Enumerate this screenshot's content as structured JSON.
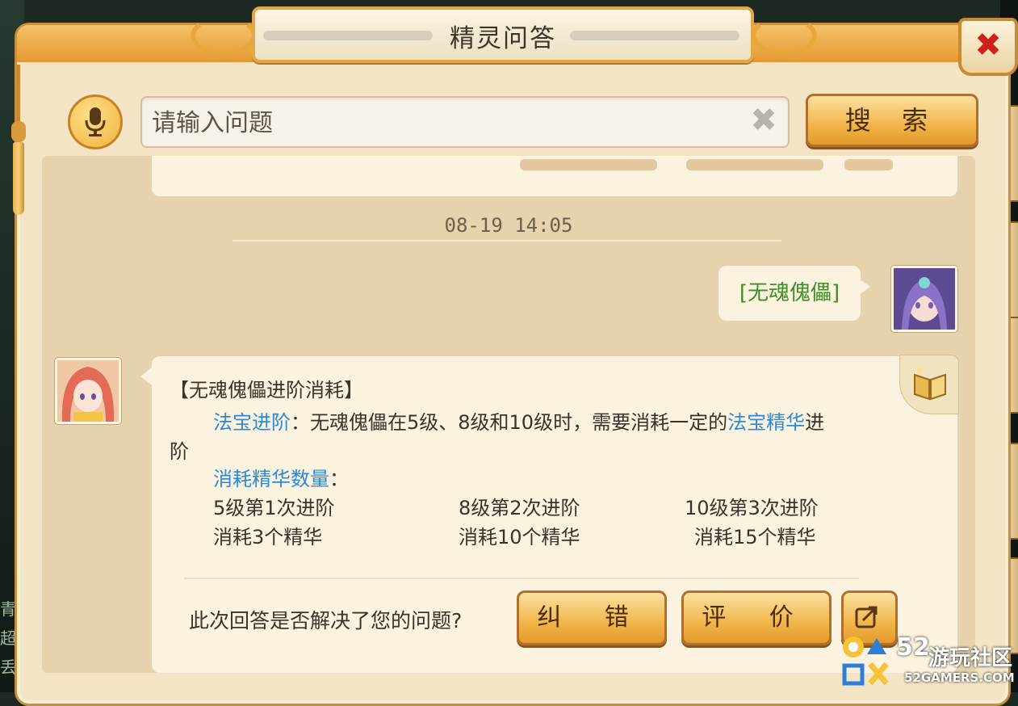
{
  "window": {
    "title": "精灵问答"
  },
  "search": {
    "placeholder": "请输入问题",
    "value": "",
    "button_label": "搜 索"
  },
  "chat": {
    "timestamp": "08-19 14:05",
    "user_message": "[无魂傀儡]",
    "answer": {
      "title": "【无魂傀儡进阶消耗】",
      "line1_link": "法宝进阶",
      "line1_text": "：无魂傀儡在5级、8级和10级时，需要消耗一定的",
      "line1_link2": "法宝精华",
      "line1_tail": "进",
      "line2": "阶",
      "cost_heading": "消耗精华数量",
      "cost_heading_colon": "：",
      "tiers": [
        {
          "level": "5级第1次进阶",
          "cost": "消耗3个精华"
        },
        {
          "level": "8级第2次进阶",
          "cost": "消耗10个精华"
        },
        {
          "level": "10级第3次进阶",
          "cost": "消耗15个精华"
        }
      ]
    },
    "feedback": {
      "question": "此次回答是否解决了您的问题?",
      "fix_label": "纠 错",
      "rate_label": "评 价"
    }
  },
  "background": {
    "side_chars": [
      "青",
      "超",
      "丢"
    ]
  },
  "watermark": {
    "number": "52",
    "name": "游玩社区",
    "domain": "52GAMERS.COM"
  },
  "colors": {
    "accent_gold": "#f1b54a",
    "link_blue": "#2c8ad6",
    "user_green": "#3e8f27",
    "close_red": "#d0201a"
  }
}
